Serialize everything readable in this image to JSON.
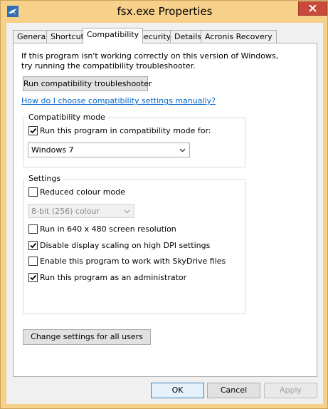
{
  "window": {
    "title": "fsx.exe Properties"
  },
  "tabs": [
    {
      "label": "General"
    },
    {
      "label": "Shortcut"
    },
    {
      "label": "Compatibility"
    },
    {
      "label": "Security"
    },
    {
      "label": "Details"
    },
    {
      "label": "Acronis Recovery"
    }
  ],
  "intro": {
    "line1": "If this program isn't working correctly on this version of Windows,",
    "line2": "try running the compatibility troubleshooter."
  },
  "troubleshooter_button": "Run compatibility troubleshooter",
  "help_link": "How do I choose compatibility settings manually?",
  "compat_mode": {
    "title": "Compatibility mode",
    "checkbox_label": "Run this program in compatibility mode for:",
    "checked": true,
    "selected_os": "Windows 7"
  },
  "settings": {
    "title": "Settings",
    "reduced_colour": {
      "label": "Reduced colour mode",
      "checked": false
    },
    "colour_select": "8-bit (256) colour",
    "resolution": {
      "label": "Run in 640 x 480 screen resolution",
      "checked": false
    },
    "dpi": {
      "label": "Disable display scaling on high DPI settings",
      "checked": true
    },
    "skydrive": {
      "label": "Enable this program to work with SkyDrive files",
      "checked": false
    },
    "admin": {
      "label": "Run this program as an administrator",
      "checked": true
    }
  },
  "change_all_button": "Change settings for all users",
  "footer": {
    "ok": "OK",
    "cancel": "Cancel",
    "apply": "Apply"
  }
}
